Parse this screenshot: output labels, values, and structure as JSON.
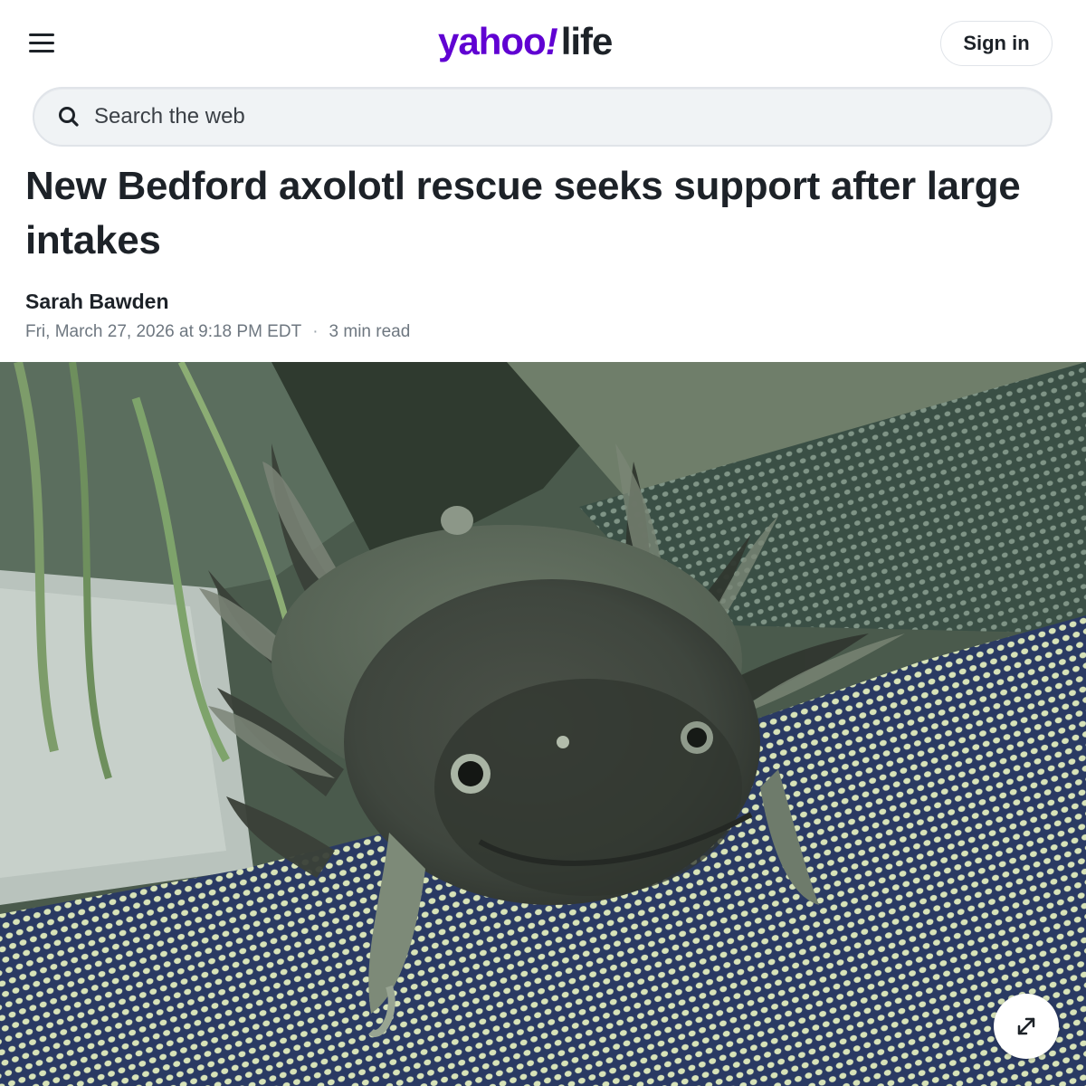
{
  "header": {
    "menu_icon": "hamburger-menu-icon",
    "logo": {
      "brand": "yahoo",
      "bang": "!",
      "section": "life",
      "brand_color": "#6001d2"
    },
    "sign_in_label": "Sign in"
  },
  "search": {
    "placeholder": "Search the web",
    "value": "",
    "icon": "search-icon"
  },
  "article": {
    "headline": "New Bedford axolotl rescue seeks support after large intakes",
    "author": "Sarah Bawden",
    "published": "Fri, March 27, 2026 at 9:18 PM EDT",
    "separator": "·",
    "read_time": "3 min read"
  },
  "hero_image": {
    "subject": "axolotl",
    "expand_icon": "expand-arrows-icon"
  }
}
